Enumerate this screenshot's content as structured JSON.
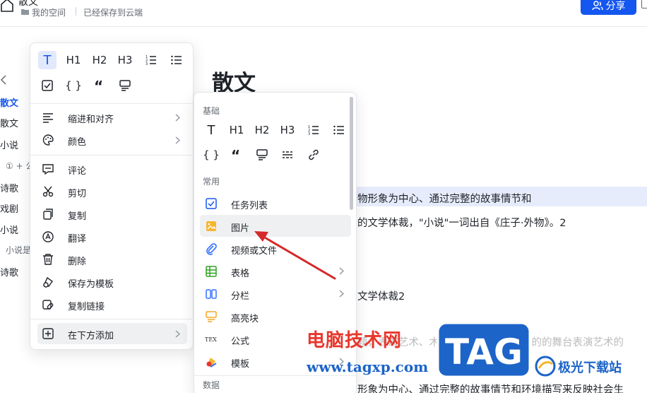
{
  "header": {
    "doc_title": "散文",
    "breadcrumb_space": "我的空间",
    "save_status": "已经保存到云端",
    "share_label": "分享"
  },
  "outline": {
    "items": [
      "散文",
      "散文",
      "小说",
      "① + 公",
      "诗歌",
      "戏剧",
      "小说",
      "小说是",
      "诗歌"
    ]
  },
  "document": {
    "heading": "散文",
    "lines": [
      "物形象为中心、通过完整的故事情节和",
      "的文学体裁，\"小说\"一词出自《庄子·外物》。2",
      "文学体裁2",
      "题，表演艺术、木偶等形式达到叙事目的的舞台表演艺术的",
      "形象为中心、通过完整的故事情节和环境描写来反映社会生"
    ]
  },
  "left_menu": {
    "format_row1": [
      "T",
      "H1",
      "H2",
      "H3",
      "ordered-list",
      "bullet-list"
    ],
    "format_row2": [
      "checkbox",
      "{ }",
      "quote",
      "callout"
    ],
    "items": [
      {
        "label": "缩进和对齐",
        "icon": "align-left-icon",
        "submenu": true
      },
      {
        "label": "颜色",
        "icon": "palette-icon",
        "submenu": true
      },
      {
        "label": "评论",
        "icon": "comment-icon",
        "submenu": false
      },
      {
        "label": "剪切",
        "icon": "scissors-icon",
        "submenu": false
      },
      {
        "label": "复制",
        "icon": "copy-icon",
        "submenu": false
      },
      {
        "label": "翻译",
        "icon": "translate-icon",
        "submenu": false
      },
      {
        "label": "删除",
        "icon": "trash-icon",
        "submenu": false
      },
      {
        "label": "保存为模板",
        "icon": "template-save-icon",
        "submenu": false
      },
      {
        "label": "复制链接",
        "icon": "link-icon",
        "submenu": false
      },
      {
        "label": "在下方添加",
        "icon": "add-below-icon",
        "submenu": true
      }
    ]
  },
  "right_menu": {
    "section_basic": "基础",
    "section_common": "常用",
    "section_data": "数据",
    "basic_row2_labels": [
      "{ }"
    ],
    "items": [
      {
        "label": "任务列表",
        "icon": "checkbox-icon",
        "submenu": false
      },
      {
        "label": "图片",
        "icon": "image-icon",
        "submenu": false
      },
      {
        "label": "视频或文件",
        "icon": "attachment-icon",
        "submenu": false
      },
      {
        "label": "表格",
        "icon": "table-icon",
        "submenu": true
      },
      {
        "label": "分栏",
        "icon": "columns-icon",
        "submenu": true
      },
      {
        "label": "高亮块",
        "icon": "highlight-block-icon",
        "submenu": false
      },
      {
        "label": "公式",
        "icon": "formula-icon",
        "submenu": false
      },
      {
        "label": "模板",
        "icon": "template-icon",
        "submenu": true
      }
    ]
  },
  "watermark": {
    "site_name": "电脑技术网",
    "url": "www.tagxp.com",
    "badge": "TAG",
    "download_site": "极光下载站"
  },
  "colors": {
    "accent": "#1456f0",
    "watermark_red": "#e8372c",
    "watermark_blue": "#1c64c8",
    "arrow_red": "#d42a2a"
  }
}
